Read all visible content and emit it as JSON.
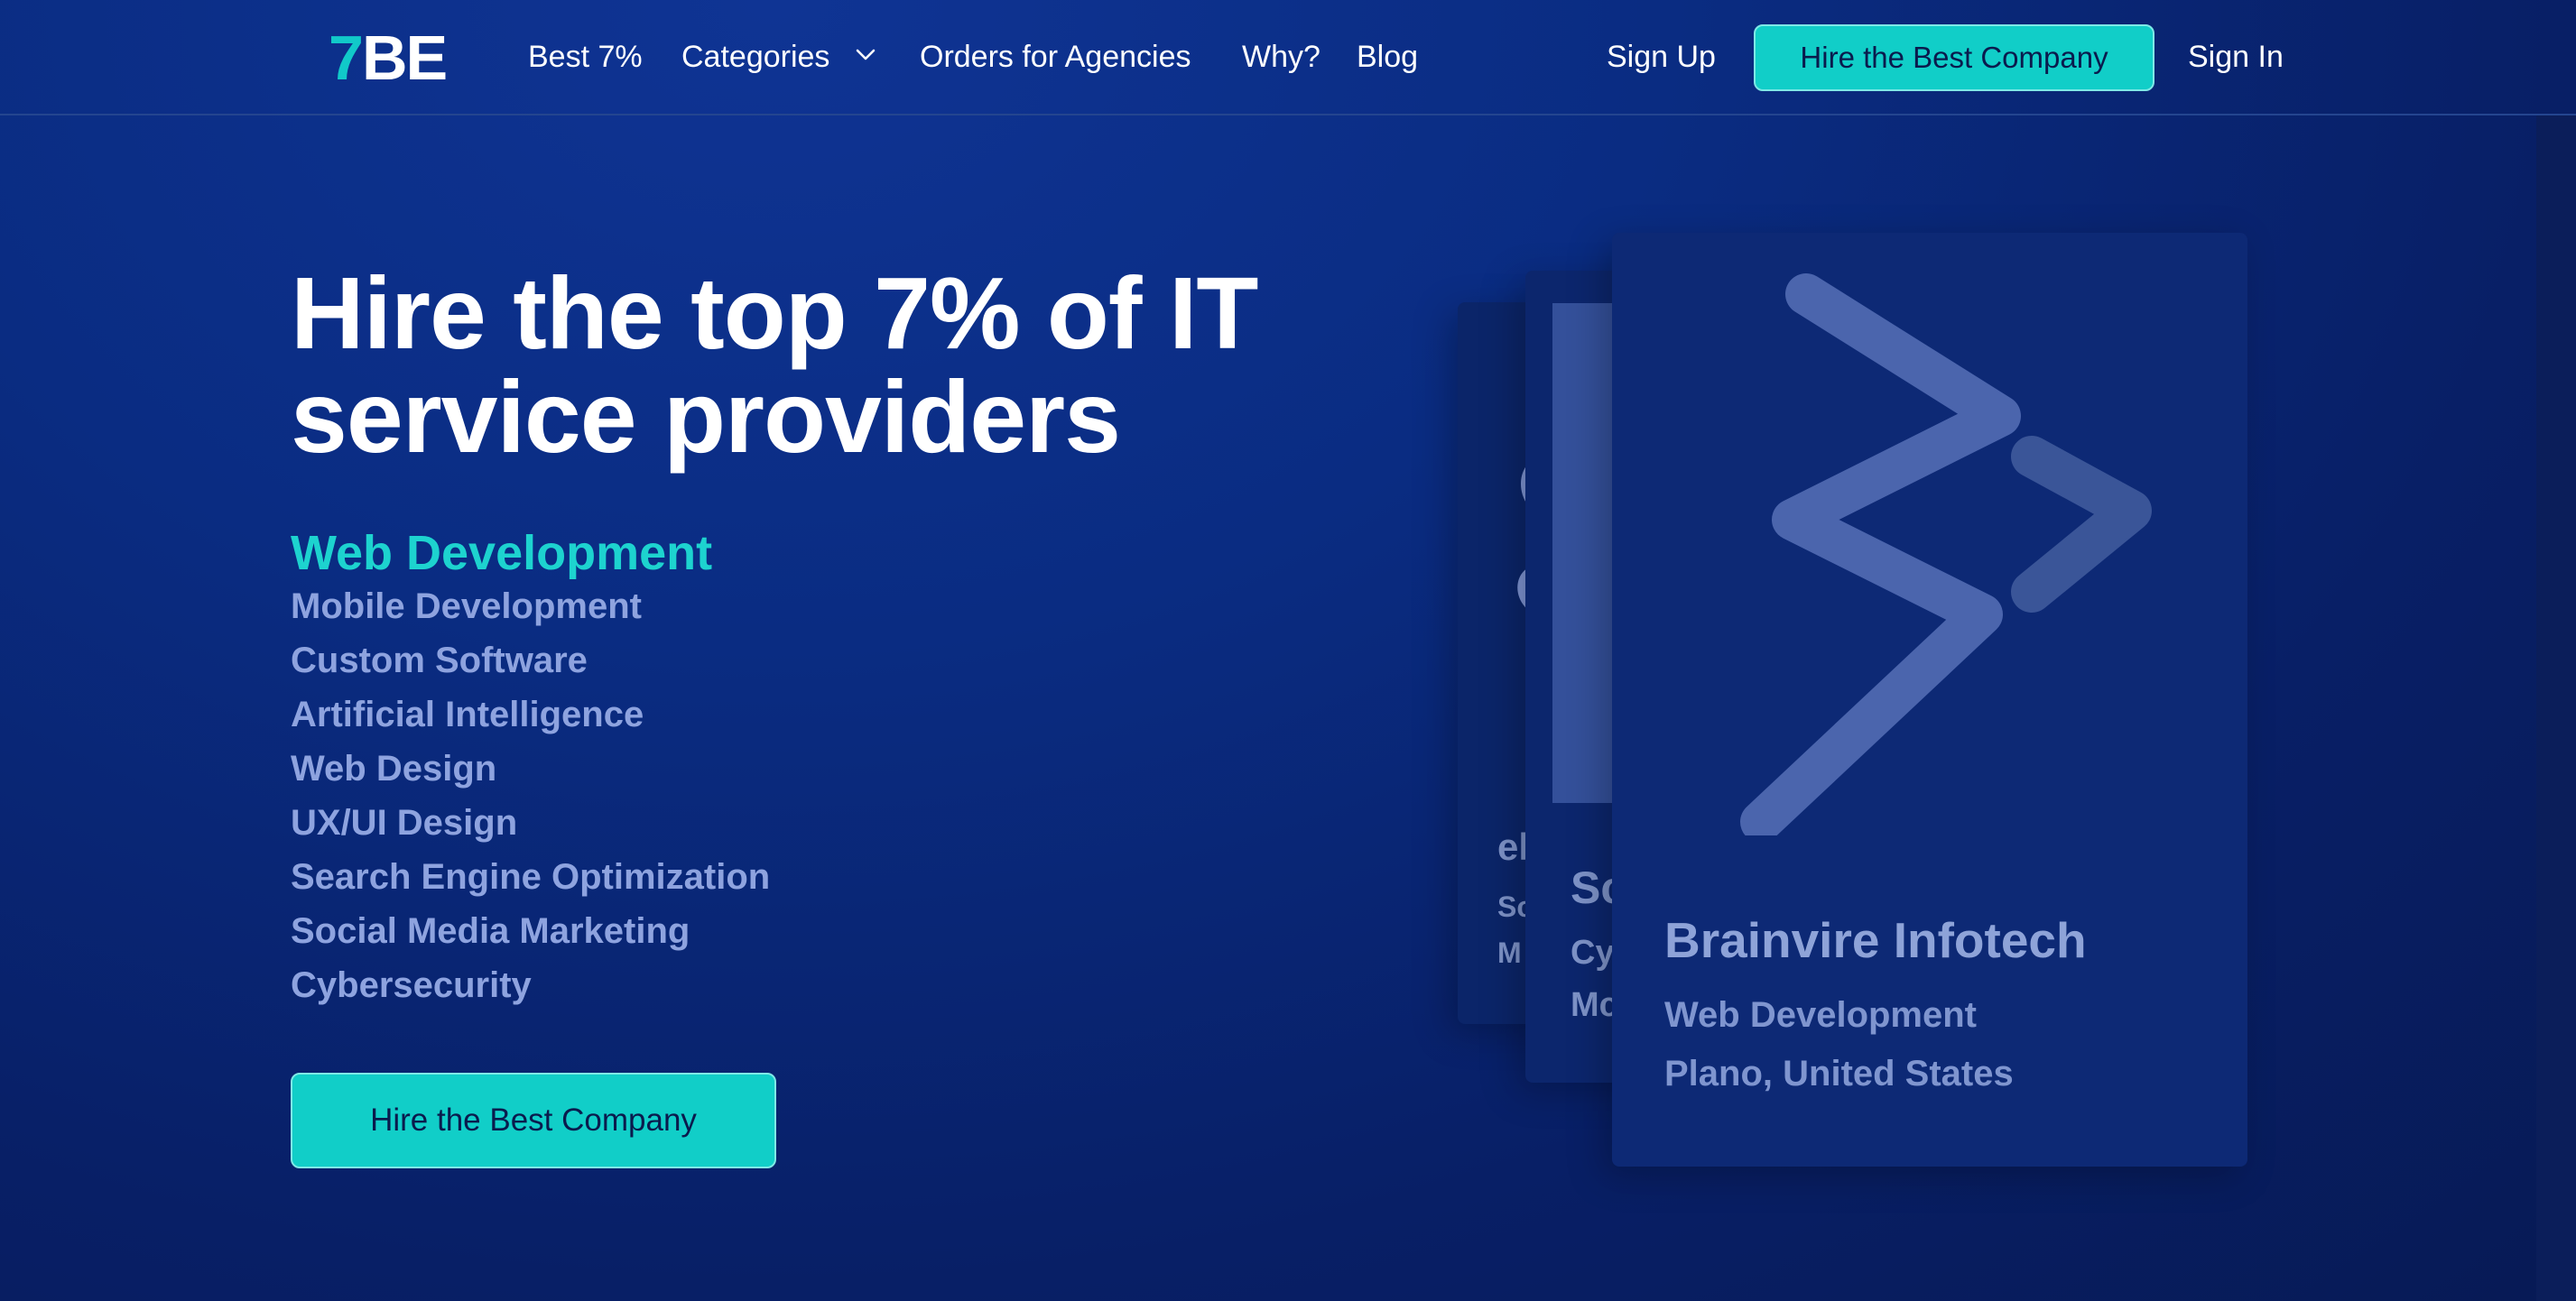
{
  "header": {
    "logo": {
      "part1": "7",
      "part2": "BE"
    },
    "nav": {
      "best": "Best 7%",
      "categories": "Categories",
      "agencies": "Orders for Agencies",
      "why": "Why?",
      "blog": "Blog"
    },
    "signup": "Sign Up",
    "cta": "Hire the Best Company",
    "signin": "Sign In"
  },
  "hero": {
    "title_line1": "Hire the top 7% of IT",
    "title_line2": "service providers",
    "active_category": "Web Development",
    "categories": [
      "Mobile Development",
      "Custom Software",
      "Artificial Intelligence",
      "Web Design",
      "UX/UI Design",
      "Search Engine Optimization",
      "Social Media Marketing",
      "Cybersecurity"
    ],
    "cta": "Hire the Best Company"
  },
  "cards": {
    "back": {
      "name_fragment": "el",
      "line1_fragment": "Sc",
      "line2_fragment": "M"
    },
    "middle": {
      "name_fragment": "Sc",
      "line1_fragment": "Cy",
      "line2_fragment": "Mc"
    },
    "front": {
      "name": "Brainvire Infotech",
      "category": "Web Development",
      "location": "Plano, United States",
      "logo_icon": "brainvire-logo-icon"
    }
  },
  "colors": {
    "accent": "#11cec8",
    "background": "#0a2c82",
    "muted_text": "#8ea3df"
  }
}
